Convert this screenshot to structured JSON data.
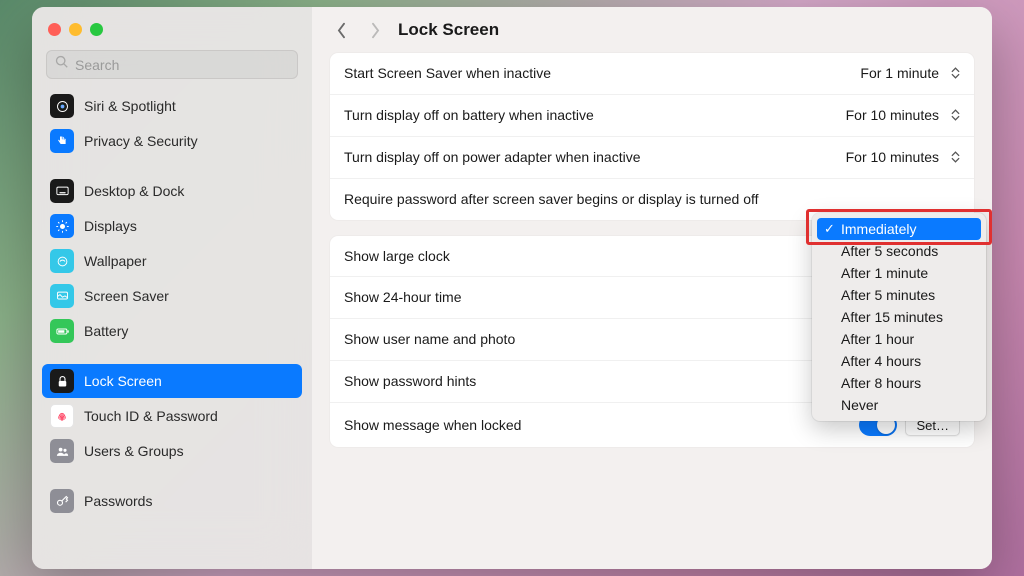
{
  "window": {
    "title": "Lock Screen"
  },
  "search": {
    "placeholder": "Search"
  },
  "sidebar": {
    "items": [
      {
        "label": "Siri & Spotlight"
      },
      {
        "label": "Privacy & Security"
      },
      {
        "label": "Desktop & Dock"
      },
      {
        "label": "Displays"
      },
      {
        "label": "Wallpaper"
      },
      {
        "label": "Screen Saver"
      },
      {
        "label": "Battery"
      },
      {
        "label": "Lock Screen"
      },
      {
        "label": "Touch ID & Password"
      },
      {
        "label": "Users & Groups"
      },
      {
        "label": "Passwords"
      }
    ],
    "selected_index": 7
  },
  "settings": {
    "group1": [
      {
        "label": "Start Screen Saver when inactive",
        "value": "For 1 minute"
      },
      {
        "label": "Turn display off on battery when inactive",
        "value": "For 10 minutes"
      },
      {
        "label": "Turn display off on power adapter when inactive",
        "value": "For 10 minutes"
      },
      {
        "label": "Require password after screen saver begins or display is turned off",
        "value": "Immediately"
      }
    ],
    "group2": [
      {
        "label": "Show large clock"
      },
      {
        "label": "Show 24-hour time"
      },
      {
        "label": "Show user name and photo"
      },
      {
        "label": "Show password hints"
      },
      {
        "label": "Show message when locked",
        "toggle": true,
        "button": "Set…"
      }
    ]
  },
  "dropdown": {
    "selected_index": 0,
    "options": [
      "Immediately",
      "After 5 seconds",
      "After 1 minute",
      "After 5 minutes",
      "After 15 minutes",
      "After 1 hour",
      "After 4 hours",
      "After 8 hours",
      "Never"
    ]
  }
}
